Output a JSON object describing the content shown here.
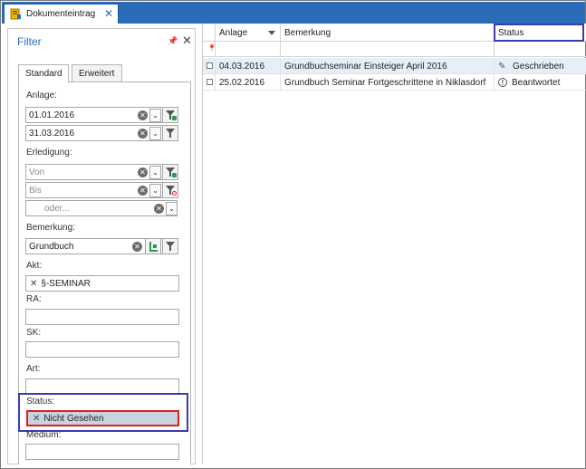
{
  "window": {
    "tab_title": "Dokumenteintrag"
  },
  "filter_panel": {
    "title": "Filter",
    "tabs": [
      "Standard",
      "Erweitert"
    ],
    "anlage": {
      "label": "Anlage:",
      "from": "01.01.2016",
      "to": "31.03.2016"
    },
    "erledigung": {
      "label": "Erledigung:",
      "from_placeholder": "Von",
      "to_placeholder": "Bis",
      "or_placeholder": "oder..."
    },
    "bemerkung": {
      "label": "Bemerkung:",
      "value": "Grundbuch"
    },
    "akt": {
      "label": "Akt:",
      "token": "§-SEMINAR"
    },
    "ra": {
      "label": "RA:"
    },
    "sk": {
      "label": "SK:"
    },
    "art": {
      "label": "Art:"
    },
    "status": {
      "label": "Status:",
      "token": "Nicht Gesehen"
    },
    "medium": {
      "label": "Medium:"
    }
  },
  "grid": {
    "columns": [
      "Anlage",
      "Bemerkung",
      "Status"
    ],
    "rows": [
      {
        "anlage": "04.03.2016",
        "bemerkung": "Grundbuchseminar Einsteiger April 2016",
        "status": "Geschrieben",
        "status_icon": "pencil-icon",
        "selected": true
      },
      {
        "anlage": "25.02.2016",
        "bemerkung": "Grundbuch Seminar Fortgeschrittene in Niklasdorf",
        "status": "Beantwortet",
        "status_icon": "exclamation-icon",
        "selected": false
      }
    ]
  },
  "colors": {
    "accent": "#2b6cb8",
    "highlight_blue": "#3a3ab5",
    "highlight_red": "#e01e1e",
    "selected_row": "#e6eff8"
  }
}
